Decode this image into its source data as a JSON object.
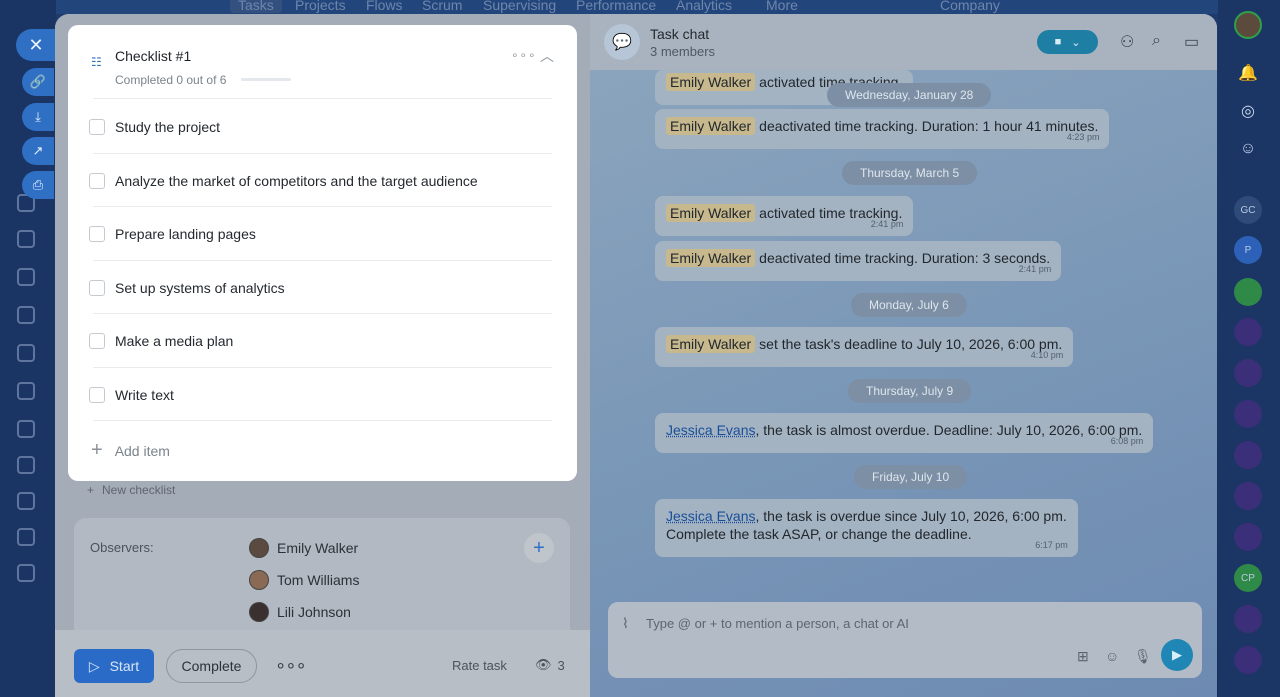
{
  "background_menu": [
    "Tasks",
    "Projects",
    "Flows",
    "Scrum",
    "Supervising",
    "Performance",
    "Analytics",
    "More"
  ],
  "company_search": "Company",
  "checklist": {
    "title": "Checklist #1",
    "progress_text": "Completed 0 out of 6",
    "progress_fraction": 0,
    "items": [
      {
        "label": "Study the project",
        "checked": false
      },
      {
        "label": "Analyze the market of competitors and the target audience",
        "checked": false
      },
      {
        "label": "Prepare landing pages",
        "checked": false
      },
      {
        "label": "Set up systems of analytics",
        "checked": false
      },
      {
        "label": "Make a media plan",
        "checked": false
      },
      {
        "label": "Write text",
        "checked": false
      }
    ],
    "add_item_label": "Add item"
  },
  "new_checklist_label": "New checklist",
  "observers": {
    "label": "Observers:",
    "people": [
      "Emily Walker",
      "Tom Williams",
      "Lili Johnson"
    ]
  },
  "footer": {
    "start_label": "Start",
    "complete_label": "Complete",
    "rate_label": "Rate task",
    "views_count": "3"
  },
  "chat": {
    "title": "Task chat",
    "members": "3 members",
    "composer_placeholder": "Type @ or + to mention a person, a chat or AI",
    "dates": [
      "Wednesday, January 28",
      "Thursday, March 5",
      "Monday, July 6",
      "Thursday, July 9",
      "Friday, July 10"
    ],
    "messages": [
      {
        "name": "Emily Walker",
        "text": "activated time tracking.",
        "time": ""
      },
      {
        "name": "Emily Walker",
        "text": "deactivated time tracking. Duration: 1 hour 41 minutes.",
        "time": "4:23 pm"
      },
      {
        "name": "Emily Walker",
        "text": "activated time tracking.",
        "time": "2:41 pm"
      },
      {
        "name": "Emily Walker",
        "text": "deactivated time tracking. Duration: 3 seconds.",
        "time": "2:41 pm"
      },
      {
        "name": "Emily Walker",
        "text": "set the task's deadline to July 10, 2026, 6:00 pm.",
        "time": "4:10 pm"
      },
      {
        "name": "Jessica Evans",
        "text": ", the task is almost overdue. Deadline: July 10, 2026, 6:00 pm.",
        "time": "6:08 pm"
      },
      {
        "name": "Jessica Evans",
        "text": ", the task is overdue since July 10, 2026, 6:00 pm.",
        "text2": "Complete the task ASAP, or change the deadline.",
        "time": "6:17 pm"
      }
    ]
  },
  "right_sidebar": {
    "badges": [
      "GC",
      "P",
      "CP"
    ]
  },
  "colors": {
    "accent": "#2f6fc4",
    "panel_bg": "#ffffff",
    "chat_accent": "#1f86b5"
  }
}
